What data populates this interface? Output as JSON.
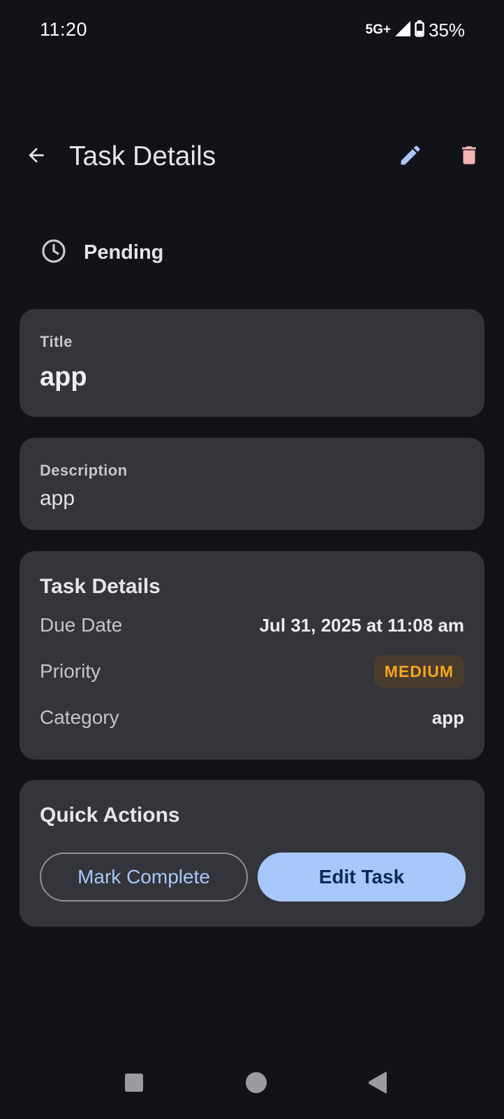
{
  "status_bar": {
    "time": "11:20",
    "network": "5G+",
    "battery": "35%",
    "icons": [
      "signal-icon",
      "battery-icon"
    ]
  },
  "app_bar": {
    "title": "Task Details",
    "icons": [
      "back-arrow-icon",
      "pencil-icon",
      "trash-icon"
    ]
  },
  "task_status": {
    "label": "Pending",
    "icon": "clock-icon"
  },
  "title_card": {
    "label": "Title",
    "value": "app"
  },
  "description_card": {
    "label": "Description",
    "value": "app"
  },
  "details_card": {
    "heading": "Task Details",
    "rows": [
      {
        "label": "Due Date",
        "value": "Jul 31, 2025 at 11:08 am"
      },
      {
        "label": "Priority",
        "value": "MEDIUM"
      },
      {
        "label": "Category",
        "value": "app"
      }
    ]
  },
  "actions_card": {
    "heading": "Quick Actions",
    "mark_complete_label": "Mark Complete",
    "edit_task_label": "Edit Task"
  },
  "nav_bar": {
    "icons": [
      "recents-icon",
      "home-icon",
      "back-icon"
    ]
  },
  "colors": {
    "background": "#121318",
    "card": "#33353b",
    "accent": "#a8c7fa",
    "delete": "#f4b4b0",
    "priority_text": "#f5a623",
    "priority_bg": "#4a3c2c"
  }
}
